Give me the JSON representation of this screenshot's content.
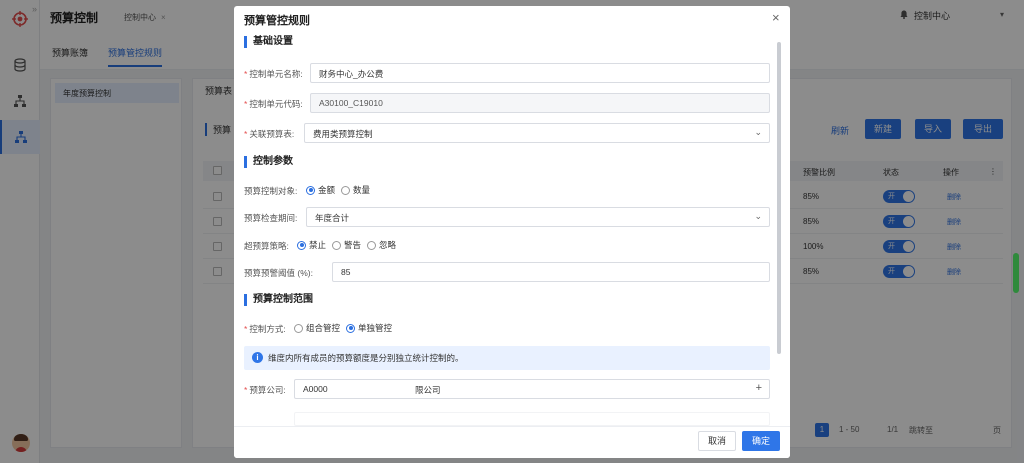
{
  "app": {
    "title": "预算控制",
    "tab": "控制中心",
    "tab_close": "×",
    "user_center": "控制中心"
  },
  "rail": {
    "icons": [
      "target-icon",
      "database-icon",
      "hierarchy-icon",
      "org-chart-icon"
    ]
  },
  "subnav": {
    "tabs": [
      "预算账簿",
      "预算管控规则"
    ],
    "active": 1
  },
  "left_panel": {
    "item": "年度预算控制"
  },
  "main": {
    "label": "预算表",
    "sub": "预算",
    "refresh": "刷新",
    "buttons": {
      "new": "新建",
      "import": "导入",
      "export": "导出"
    },
    "columns": {
      "ratio": "预警比例",
      "status": "状态",
      "ops": "操作"
    },
    "rows": [
      {
        "ratio": "85%",
        "status": "开",
        "op": "删除"
      },
      {
        "ratio": "85%",
        "status": "开",
        "op": "删除"
      },
      {
        "ratio": "100%",
        "status": "开",
        "op": "删除"
      },
      {
        "ratio": "85%",
        "status": "开",
        "op": "删除"
      }
    ],
    "pager": {
      "current": "1",
      "total": "1/1",
      "jump": "跳转至",
      "page": "页",
      "range": "1 - 50"
    }
  },
  "modal": {
    "title": "预算管控规则",
    "close": "×",
    "sections": {
      "basic": "基础设置",
      "params": "控制参数",
      "scope": "预算控制范围"
    },
    "fields": {
      "unit_name": {
        "label": "控制单元名称:",
        "value": "财务中心_办公费"
      },
      "unit_code": {
        "label": "控制单元代码:",
        "value": "A30100_C19010"
      },
      "linked_table": {
        "label": "关联预算表:",
        "value": "费用类预算控制"
      },
      "control_object": {
        "label": "预算控制对象:",
        "options": [
          "金额",
          "数量"
        ],
        "selected": 0
      },
      "check_period": {
        "label": "预算检查期间:",
        "value": "年度合计"
      },
      "over_strategy": {
        "label": "超预算策略:",
        "options": [
          "禁止",
          "警告",
          "忽略"
        ],
        "selected": 0
      },
      "warn_threshold": {
        "label": "预算预警阈值 (%):",
        "value": "85"
      },
      "control_mode": {
        "label": "控制方式:",
        "options": [
          "组合管控",
          "单独管控"
        ],
        "selected": 1
      },
      "company": {
        "label": "预算公司:",
        "value": "A0000",
        "name": "限公司",
        "add": "+"
      }
    },
    "info": "维度内所有成员的预算额度是分别独立统计控制的。",
    "buttons": {
      "cancel": "取消",
      "ok": "确定"
    }
  }
}
